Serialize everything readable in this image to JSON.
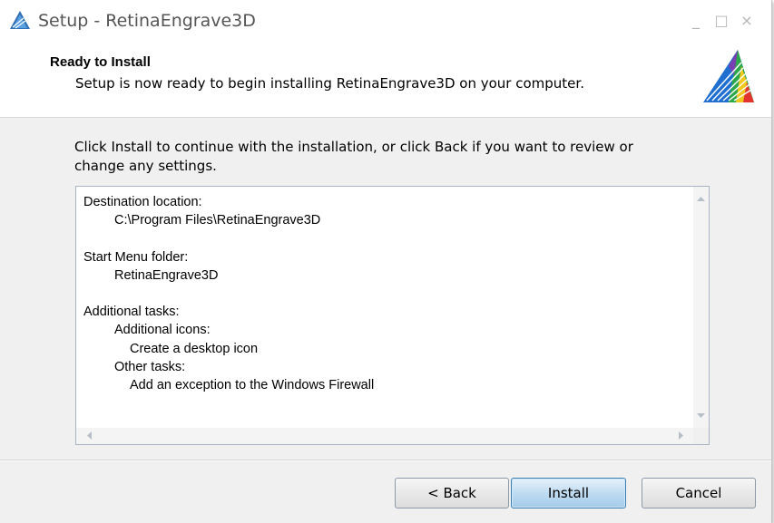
{
  "window": {
    "title": "Setup - RetinaEngrave3D",
    "icons": {
      "app": "retinaengrave-logo-icon",
      "minimize": "minimize-icon",
      "maximize": "maximize-icon",
      "close": "close-icon"
    },
    "controls": {
      "minimize": "_",
      "maximize": "□",
      "close": "×"
    }
  },
  "header": {
    "title": "Ready to Install",
    "subtitle": "Setup is now ready to begin installing RetinaEngrave3D on your computer.",
    "logo_icon": "retinaengrave-logo-icon"
  },
  "main": {
    "intro_line1": "Click Install to continue with the installation, or click Back if you want to review or",
    "intro_line2": "change any settings.",
    "summary": {
      "destination_label": "Destination location:",
      "destination_value": "C:\\Program Files\\RetinaEngrave3D",
      "startmenu_label": "Start Menu folder:",
      "startmenu_value": "RetinaEngrave3D",
      "tasks_label": "Additional tasks:",
      "icons_group": "Additional icons:",
      "icons_item": "Create a desktop icon",
      "other_group": "Other tasks:",
      "other_item": "Add an exception to the Windows Firewall"
    }
  },
  "buttons": {
    "back": "< Back",
    "install": "Install",
    "cancel": "Cancel"
  },
  "colors": {
    "dialog_bg": "#f0f0f0",
    "header_bg": "#ffffff",
    "install_button": "#bfdcf2",
    "border": "#aab4c4"
  }
}
